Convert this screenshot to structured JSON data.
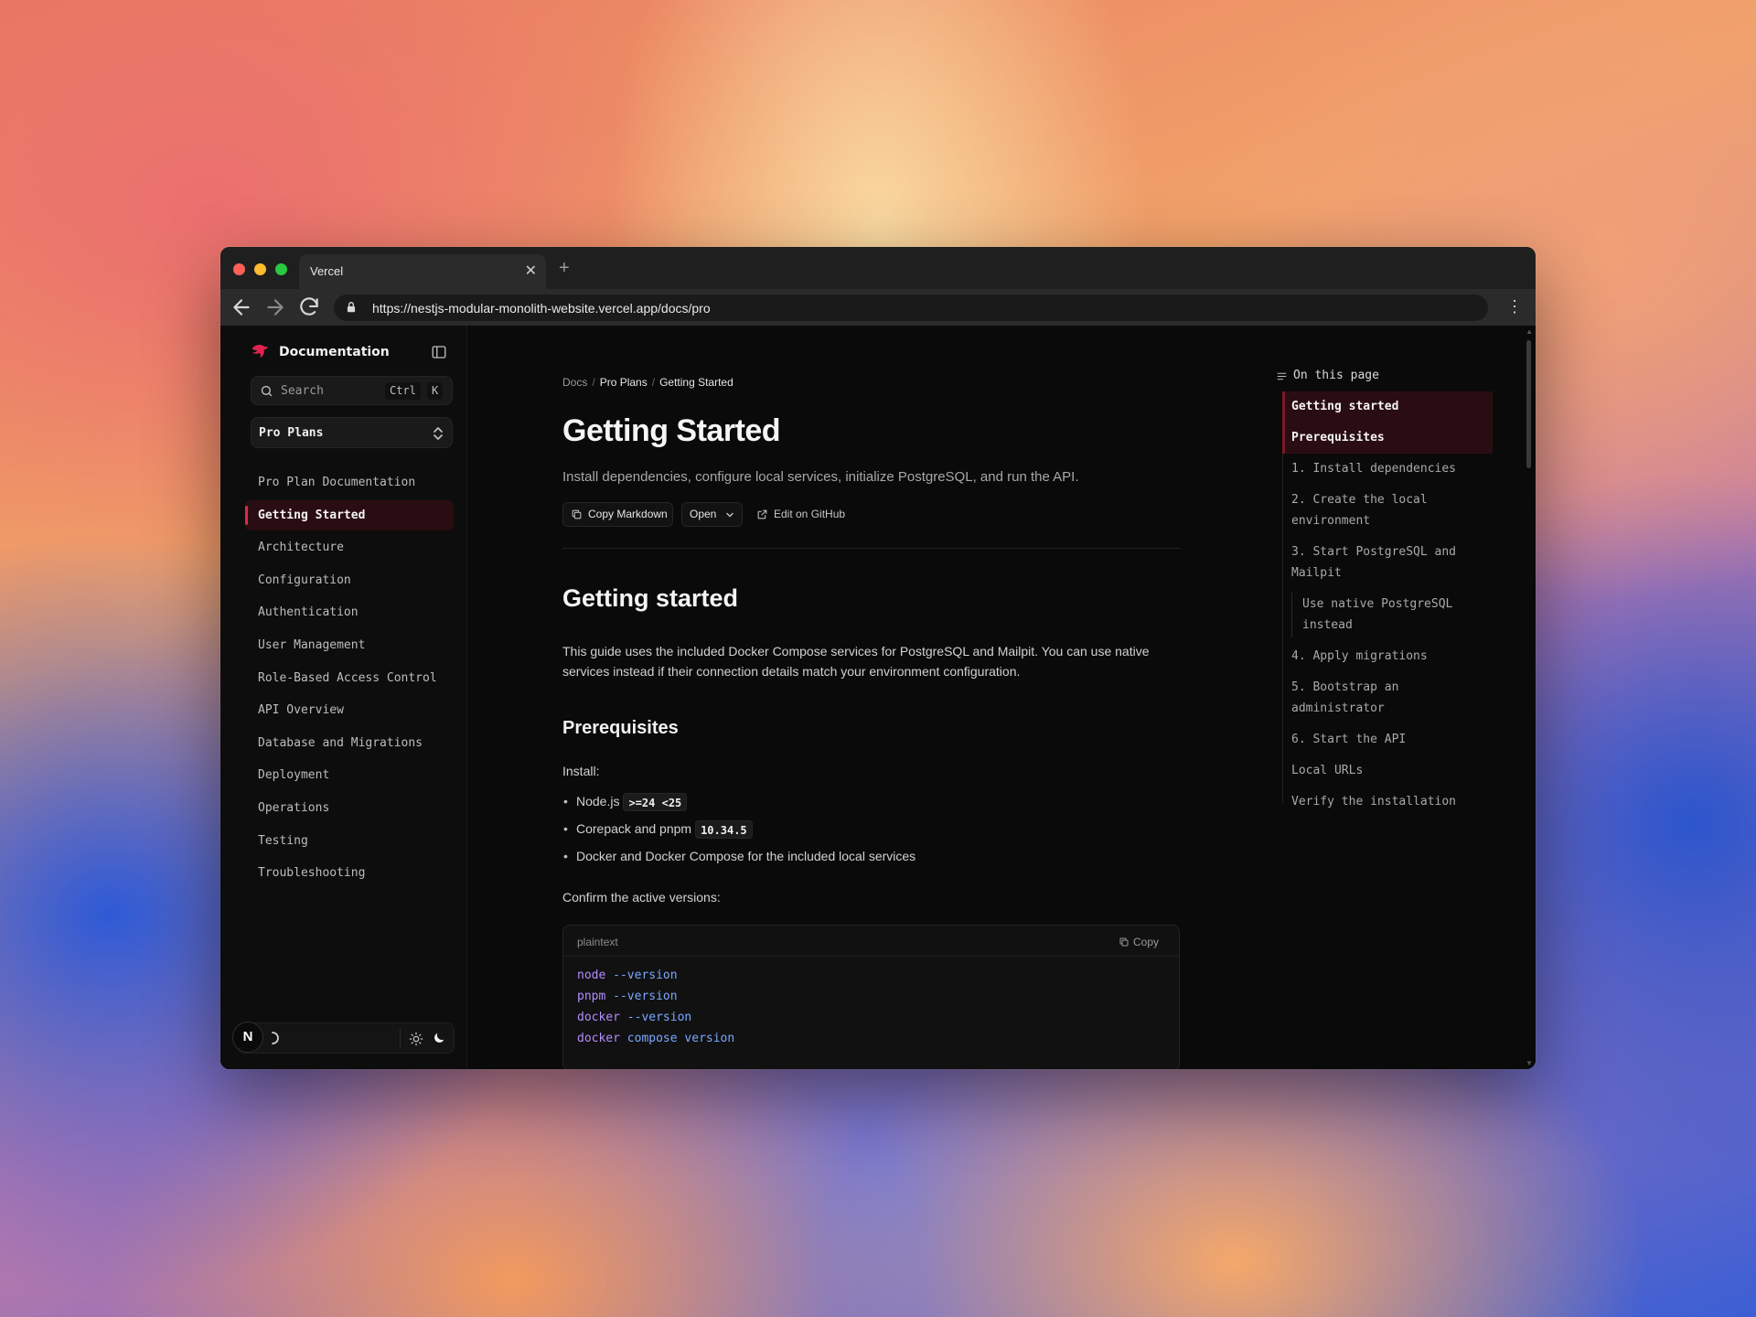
{
  "browser": {
    "tab_title": "Vercel",
    "tab_close": "✕",
    "new_tab": "+",
    "url": "https://nestjs-modular-monolith-website.vercel.app/docs/pro",
    "menu": "⋮"
  },
  "sidebar": {
    "brand": "Documentation",
    "search_placeholder": "Search",
    "shortcut_ctrl": "Ctrl",
    "shortcut_k": "K",
    "plan": "Pro Plans",
    "items": [
      {
        "label": "Pro Plan Documentation",
        "active": false
      },
      {
        "label": "Getting Started",
        "active": true
      },
      {
        "label": "Architecture",
        "active": false
      },
      {
        "label": "Configuration",
        "active": false
      },
      {
        "label": "Authentication",
        "active": false
      },
      {
        "label": "User Management",
        "active": false
      },
      {
        "label": "Role-Based Access Control",
        "active": false
      },
      {
        "label": "API Overview",
        "active": false
      },
      {
        "label": "Database and Migrations",
        "active": false
      },
      {
        "label": "Deployment",
        "active": false
      },
      {
        "label": "Operations",
        "active": false
      },
      {
        "label": "Testing",
        "active": false
      },
      {
        "label": "Troubleshooting",
        "active": false
      }
    ],
    "footer_badge": "N"
  },
  "main": {
    "breadcrumb": [
      "Docs",
      "Pro Plans",
      "Getting Started"
    ],
    "breadcrumb_sep": "/",
    "title": "Getting Started",
    "description": "Install dependencies, configure local services, initialize PostgreSQL, and run the API.",
    "actions": {
      "copy_markdown": "Copy Markdown",
      "open": "Open",
      "edit_github": "Edit on GitHub"
    },
    "section_heading": "Getting started",
    "section_body": "This guide uses the included Docker Compose services for PostgreSQL and Mailpit. You can use native services instead if their connection details match your environment configuration.",
    "prereq_heading": "Prerequisites",
    "install_label": "Install:",
    "prereqs": [
      {
        "text": "Node.js",
        "code": ">=24 <25"
      },
      {
        "text": "Corepack and pnpm",
        "code": "10.34.5"
      },
      {
        "text": "Docker and Docker Compose for the included local services",
        "code": ""
      }
    ],
    "confirm_label": "Confirm the active versions:",
    "code_block": {
      "language": "plaintext",
      "copy_label": "Copy",
      "lines": [
        {
          "cmd": "node",
          "args": "--version"
        },
        {
          "cmd": "pnpm",
          "args": "--version"
        },
        {
          "cmd": "docker",
          "args": "--version"
        },
        {
          "cmd": "docker",
          "args": "compose version"
        }
      ]
    }
  },
  "toc": {
    "heading": "On this page",
    "items": [
      {
        "label": "Getting started",
        "active": true,
        "sub": false
      },
      {
        "label": "Prerequisites",
        "active": true,
        "sub": false
      },
      {
        "label": "1. Install dependencies",
        "active": false,
        "sub": false
      },
      {
        "label": "2. Create the local environment",
        "active": false,
        "sub": false
      },
      {
        "label": "3. Start PostgreSQL and Mailpit",
        "active": false,
        "sub": false
      },
      {
        "label": "Use native PostgreSQL instead",
        "active": false,
        "sub": true
      },
      {
        "label": "4. Apply migrations",
        "active": false,
        "sub": false
      },
      {
        "label": "5. Bootstrap an administrator",
        "active": false,
        "sub": false
      },
      {
        "label": "6. Start the API",
        "active": false,
        "sub": false
      },
      {
        "label": "Local URLs",
        "active": false,
        "sub": false
      },
      {
        "label": "Verify the installation",
        "active": false,
        "sub": false
      }
    ]
  },
  "colors": {
    "accent": "#e02a44",
    "active_bg": "#2a0d12",
    "code_cmd": "#b48cff",
    "code_arg": "#7ba7ff"
  }
}
